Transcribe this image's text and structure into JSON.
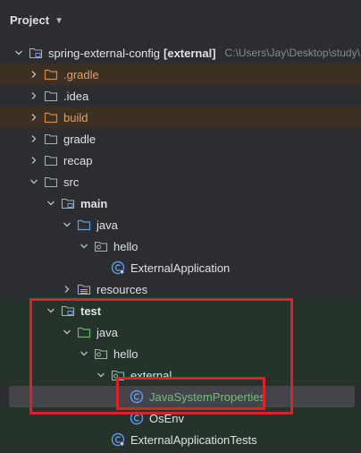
{
  "header": {
    "title": "Project",
    "chevron_icon": "chevron-down-icon"
  },
  "tree": {
    "root": {
      "label": "spring-external-config",
      "tag": "[external]",
      "path": "C:\\Users\\Jay\\Desktop\\study\\"
    },
    "gradle_hidden": ".gradle",
    "idea": ".idea",
    "build": "build",
    "gradle": "gradle",
    "recap": "recap",
    "src": "src",
    "main": "main",
    "main_java": "java",
    "main_hello": "hello",
    "external_application": "ExternalApplication",
    "resources": "resources",
    "test": "test",
    "test_java": "java",
    "test_hello": "hello",
    "external": "external",
    "java_system_properties": "JavaSystemProperties",
    "os_env": "OsEnv",
    "external_application_tests": "ExternalApplicationTests"
  },
  "colors": {
    "background": "#2b2d30",
    "excluded_bg": "#3c3024",
    "test_bg": "#26332a",
    "selected_bg": "#43454a",
    "highlight_red": "#d9232a",
    "excluded_text": "#e0a068",
    "test_text": "#73bd79"
  }
}
